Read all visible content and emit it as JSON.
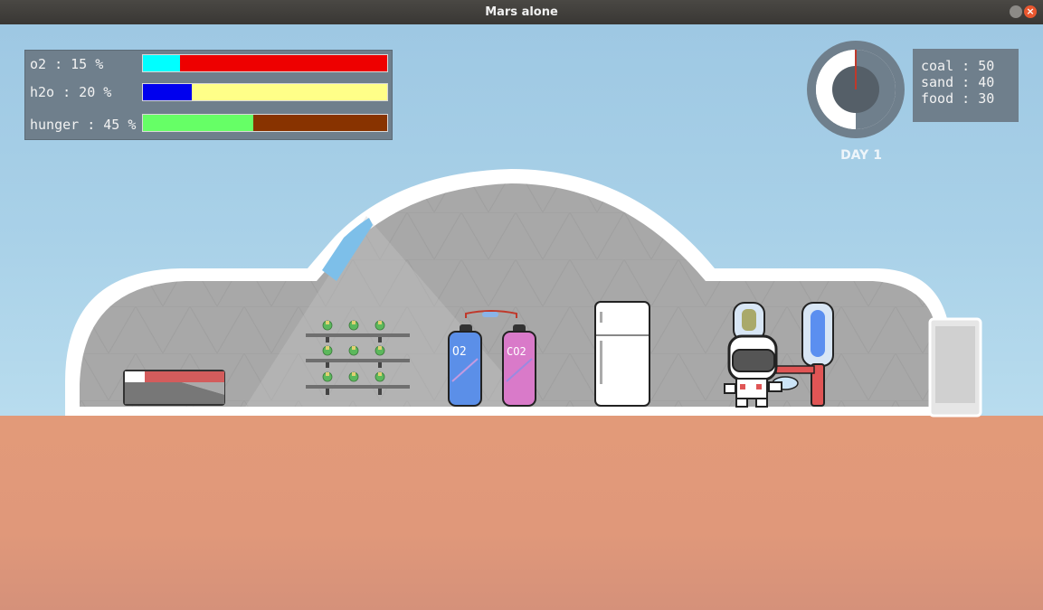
{
  "window": {
    "title": "Mars alone"
  },
  "stats": [
    {
      "label": "o2 : 15 %",
      "value": 15,
      "fill_color": "#00ffff",
      "empty_color": "#ee0000"
    },
    {
      "label": "h2o : 20 %",
      "value": 20,
      "fill_color": "#0000ee",
      "empty_color": "#ffff88"
    },
    {
      "label": "hunger : 45 %",
      "value": 45,
      "fill_color": "#66ff66",
      "empty_color": "#883300"
    }
  ],
  "resources": {
    "coal": "coal : 50",
    "sand": "sand : 40",
    "food": "food : 30"
  },
  "day": {
    "label": "DAY 1"
  },
  "tanks": {
    "o2_label": "O2",
    "co2_label": "CO2"
  },
  "colors": {
    "sky": "#a9d1e8",
    "ground": "#e29a79",
    "panel": "#6f7f8c",
    "dome_glass": "#a6a6a6",
    "dome_frame": "#ffffff"
  },
  "icons": {
    "clock": "day-clock-icon",
    "bed": "bed-icon",
    "plants": "plant-shelf-icon",
    "fridge": "fridge-icon",
    "astronaut": "astronaut-icon"
  }
}
